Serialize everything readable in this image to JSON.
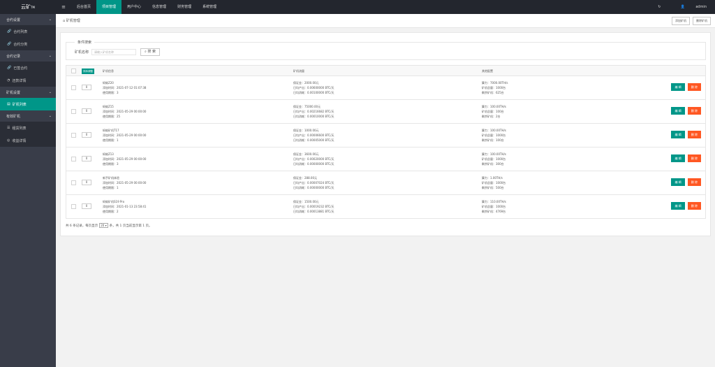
{
  "app": {
    "logo": "云矿",
    "logo_sup": "TM",
    "user": "admin"
  },
  "nav": [
    "后台首页",
    "项目管理",
    "用户中心",
    "信息管理",
    "财务管理",
    "系统管理"
  ],
  "sidebar": [
    {
      "group": "合约设置",
      "items": [
        "合约列表",
        "合约分类"
      ]
    },
    {
      "group": "合约记录",
      "items": [
        "已签合约",
        "还款详情"
      ]
    },
    {
      "group": "矿机设置",
      "items": [
        "矿机列表"
      ]
    },
    {
      "group": "有效矿机",
      "items": [
        "租赁列表",
        "收益详情"
      ]
    }
  ],
  "crumb": "矿机管理",
  "crumb_buttons": [
    "添加矿机",
    "删除矿机"
  ],
  "search": {
    "legend": "条件搜索",
    "label": "矿机名称",
    "placeholder": "请输入矿机名称",
    "button": "搜 索"
  },
  "table": {
    "sort_button": "排序调整",
    "headers": [
      "矿机信息",
      "矿机流量",
      "其他配置"
    ],
    "rows": [
      {
        "sort": "0",
        "name": "蚂蚁Z20",
        "time": "添加时间：2021-07-12 01:07:38",
        "cycle": "使用期限：3",
        "deposit": "保证金：2000.00元",
        "daily": "日均产出：0.00600000 BTC/天",
        "fee": "日均消耗：0.00100000 BTC/天",
        "power": "算力：7000.00TH/s",
        "stock": "矿机总量：1000台",
        "left": "剩余矿机：625台"
      },
      {
        "sort": "0",
        "name": "蚂蚁Z15",
        "time": "添加时间：2021-05-29 00:00:00",
        "cycle": "使用期限：25",
        "deposit": "保证金：75000.00元",
        "daily": "日均产出：0.00216682 BTC/天",
        "fee": "日均消耗：0.00010000 BTC/天",
        "power": "算力：100.00TH/s",
        "stock": "矿机总量：100台",
        "left": "剩余矿机：2台"
      },
      {
        "sort": "0",
        "name": "蚂蚁矿机T17",
        "time": "添加时间：2021-05-29 00:00:00",
        "cycle": "使用期限：1",
        "deposit": "保证金：1000.00元",
        "daily": "日均产出：0.00006600 BTC/天",
        "fee": "日均消耗：0.00005000 BTC/天",
        "power": "算力：100.00TH/s",
        "stock": "矿机总量：1000台",
        "left": "剩余矿机：100台"
      },
      {
        "sort": "0",
        "name": "蚂蚁Z13",
        "time": "添加时间：2021-05-29 00:00:00",
        "cycle": "使用期限：3",
        "deposit": "保证金：3600.00元",
        "daily": "日均产出：0.00020000 BTC/天",
        "fee": "日均消耗：0.00000000 BTC/天",
        "power": "算力：100.00TH/s",
        "stock": "矿机总量：1000台",
        "left": "剩余矿机：300台"
      },
      {
        "sort": "0",
        "name": "新手矿机体验",
        "time": "添加时间：2021-05-29 00:00:00",
        "cycle": "使用期限：1",
        "deposit": "保证金：288.00元",
        "daily": "日均产出：0.00007024 BTC/天",
        "fee": "日均消耗：0.00000000 BTC/天",
        "power": "算力：1.00TH/s",
        "stock": "矿机总量：1000台",
        "left": "剩余矿机：500台"
      },
      {
        "sort": "0",
        "name": "蚂蚁矿机S19 Pro",
        "time": "添加时间：2021-01-13 23:58:41",
        "cycle": "使用期限：2",
        "deposit": "保证金：1500.00元",
        "daily": "日均产出：0.00019232 BTC/天",
        "fee": "日均消耗：0.00013881 BTC/天",
        "power": "算力：110.00TH/s",
        "stock": "矿机总量：1000台",
        "left": "剩余矿机：4769台"
      }
    ],
    "edit": "编 辑",
    "delete": "删 除"
  },
  "pager": {
    "pre": "共 6 条记录，每页显示",
    "size": "20",
    "post": "条，共 1 页当前显示第 1 页。"
  }
}
